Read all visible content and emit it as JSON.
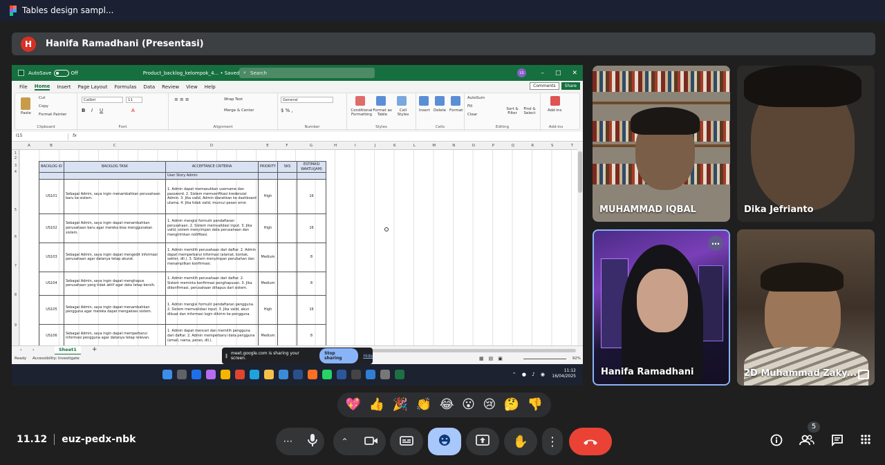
{
  "window": {
    "title": "Tables design sampl..."
  },
  "presenter": {
    "initial": "H",
    "label": "Hanifa Ramadhani (Presentasi)"
  },
  "excel": {
    "autosave": "AutoSave",
    "autosave_state": "Off",
    "doc_title": "Product_backlog_kelompok_4... • Saved to this PC ⌄",
    "search_placeholder": "Search",
    "avatar": "LS",
    "menu": [
      "File",
      "Home",
      "Insert",
      "Page Layout",
      "Formulas",
      "Data",
      "Review",
      "View",
      "Help"
    ],
    "comments": "Comments",
    "share": "Share",
    "ribbon": {
      "paste": "Paste",
      "cut": "Cut",
      "copy": "Copy",
      "format_painter": "Format Painter",
      "clipboard": "Clipboard",
      "font_name": "Calibri",
      "font_size": "11",
      "font": "Font",
      "wrap_text": "Wrap Text",
      "merge_center": "Merge & Center",
      "alignment": "Alignment",
      "number_format": "General",
      "number": "Number",
      "conditional": "Conditional Formatting",
      "format_table": "Format as Table",
      "cell_styles": "Cell Styles",
      "styles": "Styles",
      "insert": "Insert",
      "delete": "Delete",
      "format": "Format",
      "cells": "Cells",
      "autosum": "AutoSum",
      "fill": "Fill",
      "clear": "Clear",
      "sort_filter": "Sort & Filter",
      "find_select": "Find & Select",
      "editing": "Editing",
      "addins": "Add-ins",
      "addins_group": "Add-ins"
    },
    "name_box": "I15",
    "fx": "fx",
    "columns": [
      "A",
      "B",
      "C",
      "D",
      "E",
      "F",
      "G",
      "H",
      "I",
      "J",
      "K",
      "L",
      "M",
      "N",
      "O",
      "P",
      "Q",
      "R",
      "S",
      "T"
    ],
    "rows": [
      "1",
      "2",
      "3",
      "4",
      "5",
      "6",
      "7",
      "8",
      "9"
    ],
    "table": {
      "headers": [
        "BACKLOG ID",
        "BACKLOG TASK",
        "ACCEPTANCE CRITERIA",
        "PRIORITY",
        "SKS",
        "ESTIMASI WAKTU(JAM)"
      ],
      "section": "User Story Admin",
      "rows": [
        {
          "id": "US101",
          "task": "Sebagai Admin, saya ingin menambahkan perusahaan baru ke sistem.",
          "criteria": "1. Admin dapat memasukkan username dan password. 2. Sistem memverifikasi kredensial Admin. 3. Jika valid, Admin diarahkan ke dashboard utama. 4. Jika tidak valid, muncul pesan error.",
          "priority": "High",
          "sks": "",
          "est": "16"
        },
        {
          "id": "US102",
          "task": "Sebagai Admin, saya ingin dapat menambahkan perusahaan baru agar mereka bisa menggunakan sistem.",
          "criteria": "1. Admin mengisi formulir pendaftaran perusahaan. 2. Sistem memvalidasi input. 3. Jika valid, sistem menyimpan data perusahaan dan mengirimkan notifikasi.",
          "priority": "High",
          "sks": "",
          "est": "16"
        },
        {
          "id": "US103",
          "task": "Sebagai Admin, saya ingin dapat mengedit informasi perusahaan agar datanya tetap akurat.",
          "criteria": "1. Admin memilih perusahaan dari daftar. 2. Admin dapat memperbarui informasi (alamat, kontak, sektor, dll.). 3. Sistem menyimpan perubahan dan menampilkan konfirmasi.",
          "priority": "Medium",
          "sks": "",
          "est": "8"
        },
        {
          "id": "US104",
          "task": "Sebagai Admin, saya ingin dapat menghapus perusahaan yang tidak aktif agar data tetap bersih.",
          "criteria": "1. Admin memilih perusahaan dari daftar. 2. Sistem meminta konfirmasi penghapusan. 3. Jika dikonfirmasi, perusahaan dihapus dari sistem.",
          "priority": "Medium",
          "sks": "",
          "est": "8"
        },
        {
          "id": "US105",
          "task": "Sebagai Admin, saya ingin dapat menambahkan pengguna agar mereka dapat mengakses sistem.",
          "criteria": "1. Admin mengisi formulir pendaftaran pengguna. 2. Sistem memvalidasi input. 3. Jika valid, akun dibuat dan informasi login dikirim ke pengguna.",
          "priority": "High",
          "sks": "",
          "est": "16"
        },
        {
          "id": "US106",
          "task": "Sebagai Admin, saya ingin dapat memperbarui informasi pengguna agar datanya tetap relevan.",
          "criteria": "1. Admin dapat mencari dan memilih pengguna dari daftar. 2. Admin memperbarui data pengguna (email, nama, peran, dll.).",
          "priority": "Medium",
          "sks": "",
          "est": "8"
        }
      ]
    },
    "sheet_tab": "Sheet1",
    "status_ready": "Ready",
    "status_access": "Accessibility: Investigate",
    "zoom": "92%"
  },
  "share_banner": {
    "text": "meet.google.com is sharing your screen.",
    "stop": "Stop sharing",
    "hide": "Hide"
  },
  "taskbar": {
    "time": "11:12",
    "date": "16/04/2025"
  },
  "participants": [
    {
      "name": "MUHAMMAD IQBAL"
    },
    {
      "name": "Dika Jefrianto"
    },
    {
      "name": "Hanifa Ramadhani"
    },
    {
      "name": "2D Muhammad Zaky..."
    }
  ],
  "reactions": [
    "💖",
    "👍",
    "🎉",
    "👏",
    "😂",
    "😮",
    "😢",
    "🤔",
    "👎"
  ],
  "meeting": {
    "time": "11.12",
    "code": "euz-pedx-nbk",
    "participant_count": "5"
  },
  "colors": {
    "end_call": "#ea4335",
    "accent": "#8ab4f8",
    "excel_green": "#166f3e"
  }
}
